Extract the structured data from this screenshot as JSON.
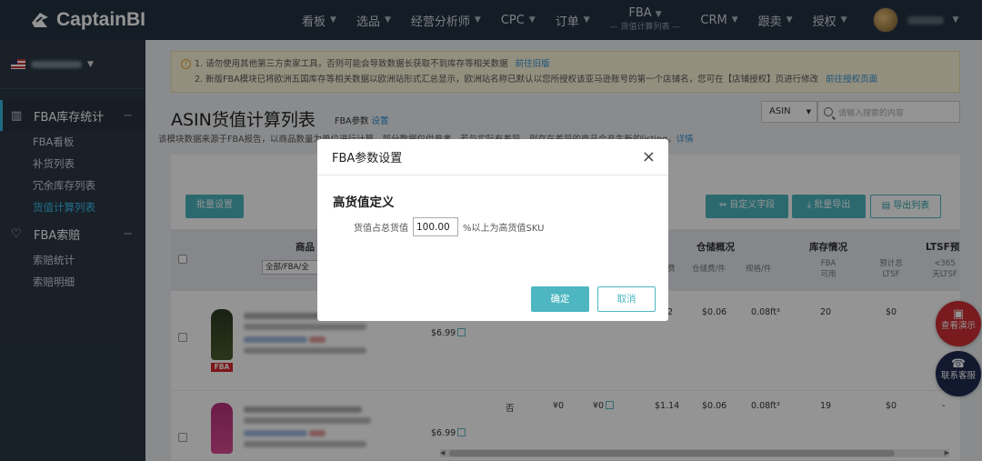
{
  "topbar": {
    "logo_text": "CaptainBI",
    "nav": [
      {
        "label": "看板"
      },
      {
        "label": "选品"
      },
      {
        "label": "经营分析师"
      },
      {
        "label": "CPC"
      },
      {
        "label": "订单"
      }
    ],
    "nav_fba": {
      "label": "FBA",
      "sublabel": "— 货值计算列表 —"
    },
    "nav_right": [
      {
        "label": "CRM"
      },
      {
        "label": "跟卖"
      },
      {
        "label": "授权"
      }
    ]
  },
  "sidebar": {
    "section1": {
      "label": "FBA库存统计",
      "toggle": "−"
    },
    "section1_items": [
      {
        "label": "FBA看板"
      },
      {
        "label": "补货列表"
      },
      {
        "label": "冗余库存列表"
      },
      {
        "label": "货值计算列表"
      }
    ],
    "section2": {
      "label": "FBA索赔",
      "toggle": "−"
    },
    "section2_items": [
      {
        "label": "索赔统计"
      },
      {
        "label": "索赔明细"
      }
    ]
  },
  "notice": {
    "line1": "1. 请勿使用其他第三方卖家工具，否则可能会导致数据长获取不到库存等相关数据",
    "line1_link": "前往旧版",
    "line2": "2. 新版FBA模块已将欧洲五国库存等相关数据以欧洲站形式汇总显示，欧洲站名称已默认以您所授权该亚马逊账号的第一个店铺名，您可在【店铺授权】页进行修改",
    "line2_link": "前往授权页面"
  },
  "page": {
    "title": "ASIN货值计算列表",
    "param_label": "FBA参数",
    "param_link": "设置",
    "description": "该模块数据来源于FBA报告，以商品数量为单位进行计算，部分数据仅供参考，若与实际有差异，则存在差异的商品会产生新的listing。",
    "description_link": "详情",
    "search_select": "ASIN",
    "search_placeholder": "请输入搜索的内容"
  },
  "toolbar": {
    "batch_settings": "批量设置",
    "custom_fields": "自定义字段",
    "batch_export": "批量导出",
    "export_list": "导出列表"
  },
  "table": {
    "col_product": "商品",
    "filter_value": "全部/FBA/全",
    "col_storage": "仓储概况",
    "col_inventory": "库存情况",
    "col_ltsf": "LTSF预",
    "sub_fee": "费",
    "sub_storage_per": "仓储费/件",
    "sub_spec_per": "规格/件",
    "sub_fba_usable": "FBA可用",
    "sub_est_ltsf": "预计总LTSF",
    "sub_365": "<365天LTSF",
    "rows": [
      {
        "badge": "FBA",
        "price": "$6.99",
        "fee": "2",
        "storage": "$0.06",
        "spec": "0.08ft³",
        "usable": "20",
        "ltsf": "$0"
      },
      {
        "badge": "",
        "price": "$6.99",
        "flag": "否",
        "v1": "¥0",
        "v2": "¥0",
        "fee": "$1.14",
        "storage": "$0.06",
        "spec": "0.08ft³",
        "usable": "19",
        "ltsf": "$0",
        "ltsf2": "-"
      }
    ]
  },
  "float_buttons": [
    {
      "label": "查看演示"
    },
    {
      "label": "联系客服"
    }
  ],
  "modal": {
    "title": "FBA参数设置",
    "close": "×",
    "section": "高货值定义",
    "field_label": "货值占总货值",
    "field_value": "100.00",
    "field_suffix": "%以上为高货值SKU",
    "ok": "确定",
    "cancel": "取消"
  },
  "colors": {
    "accent": "#4db6c0",
    "topbar": "#233140",
    "sidebar": "#2b3845",
    "highlight": "#3cc0ef",
    "fba_badge": "#d9262b"
  }
}
